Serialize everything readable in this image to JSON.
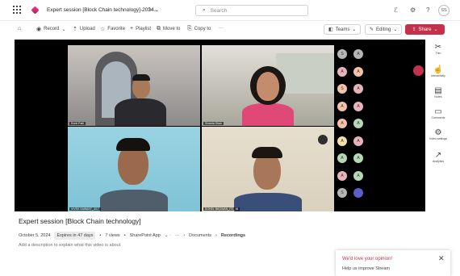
{
  "topbar": {
    "doc_title": "Expert session [Block Chain technology]-2024...",
    "search_placeholder": "Search",
    "avatar_initials": "SS"
  },
  "toolbar": {
    "record": "Record",
    "upload": "Upload",
    "favorite": "Favorite",
    "playlist": "Playlist",
    "move_to": "Move to",
    "copy_to": "Copy to",
    "more": "···",
    "teams": "Teams",
    "editing": "Editing",
    "share": "Share"
  },
  "video": {
    "tiles": [
      {
        "name": "Rohit Patil"
      },
      {
        "name": "Shweta Shah"
      },
      {
        "name": "VIVEK SAWANT_3/17"
      },
      {
        "name": "SOHEL BAGWAN_ITE_36"
      }
    ],
    "participants": [
      {
        "initials": "S",
        "color": "#b6b6b6"
      },
      {
        "initials": "A",
        "color": "#b6b6b6"
      },
      {
        "initials": "A",
        "color": "#e8b4bc"
      },
      {
        "initials": "A",
        "color": "#f3c2a8"
      },
      {
        "initials": "S",
        "color": "#f3c2a8"
      },
      {
        "initials": "A",
        "color": "#e8b4bc"
      },
      {
        "initials": "A",
        "color": "#f3c2a8"
      },
      {
        "initials": "A",
        "color": "#e8b4bc"
      },
      {
        "initials": "A",
        "color": "#f3c2a8"
      },
      {
        "initials": "A",
        "color": "#b6d8b6"
      },
      {
        "initials": "A",
        "color": "#f3e0a8"
      },
      {
        "initials": "A",
        "color": "#e8b4bc"
      },
      {
        "initials": "A",
        "color": "#b6d8b6"
      },
      {
        "initials": "A",
        "color": "#b6d8b6"
      },
      {
        "initials": "A",
        "color": "#e8b4bc"
      },
      {
        "initials": "A",
        "color": "#b6d8b6"
      },
      {
        "initials": "S",
        "color": "#b6b6b6"
      },
      {
        "initials": "",
        "color": "#5b5fc7"
      }
    ]
  },
  "side": {
    "trim": "Trim",
    "interactivity": "Interactivity",
    "notes": "Notes",
    "comments": "Comments",
    "video_settings": "Video settings",
    "analytics": "Analytics"
  },
  "details": {
    "title": "Expert session [Block Chain technology]",
    "date": "October 5, 2024",
    "expires": "Expires in 47 days",
    "views": "7 views",
    "site": "SharePoint App",
    "path_more": "···",
    "documents": "Documents",
    "recordings": "Recordings",
    "description_placeholder": "Add a description to explain what this video is about"
  },
  "feedback": {
    "heading": "We'd love your opinion!",
    "sub": "Help us improve Stream"
  }
}
